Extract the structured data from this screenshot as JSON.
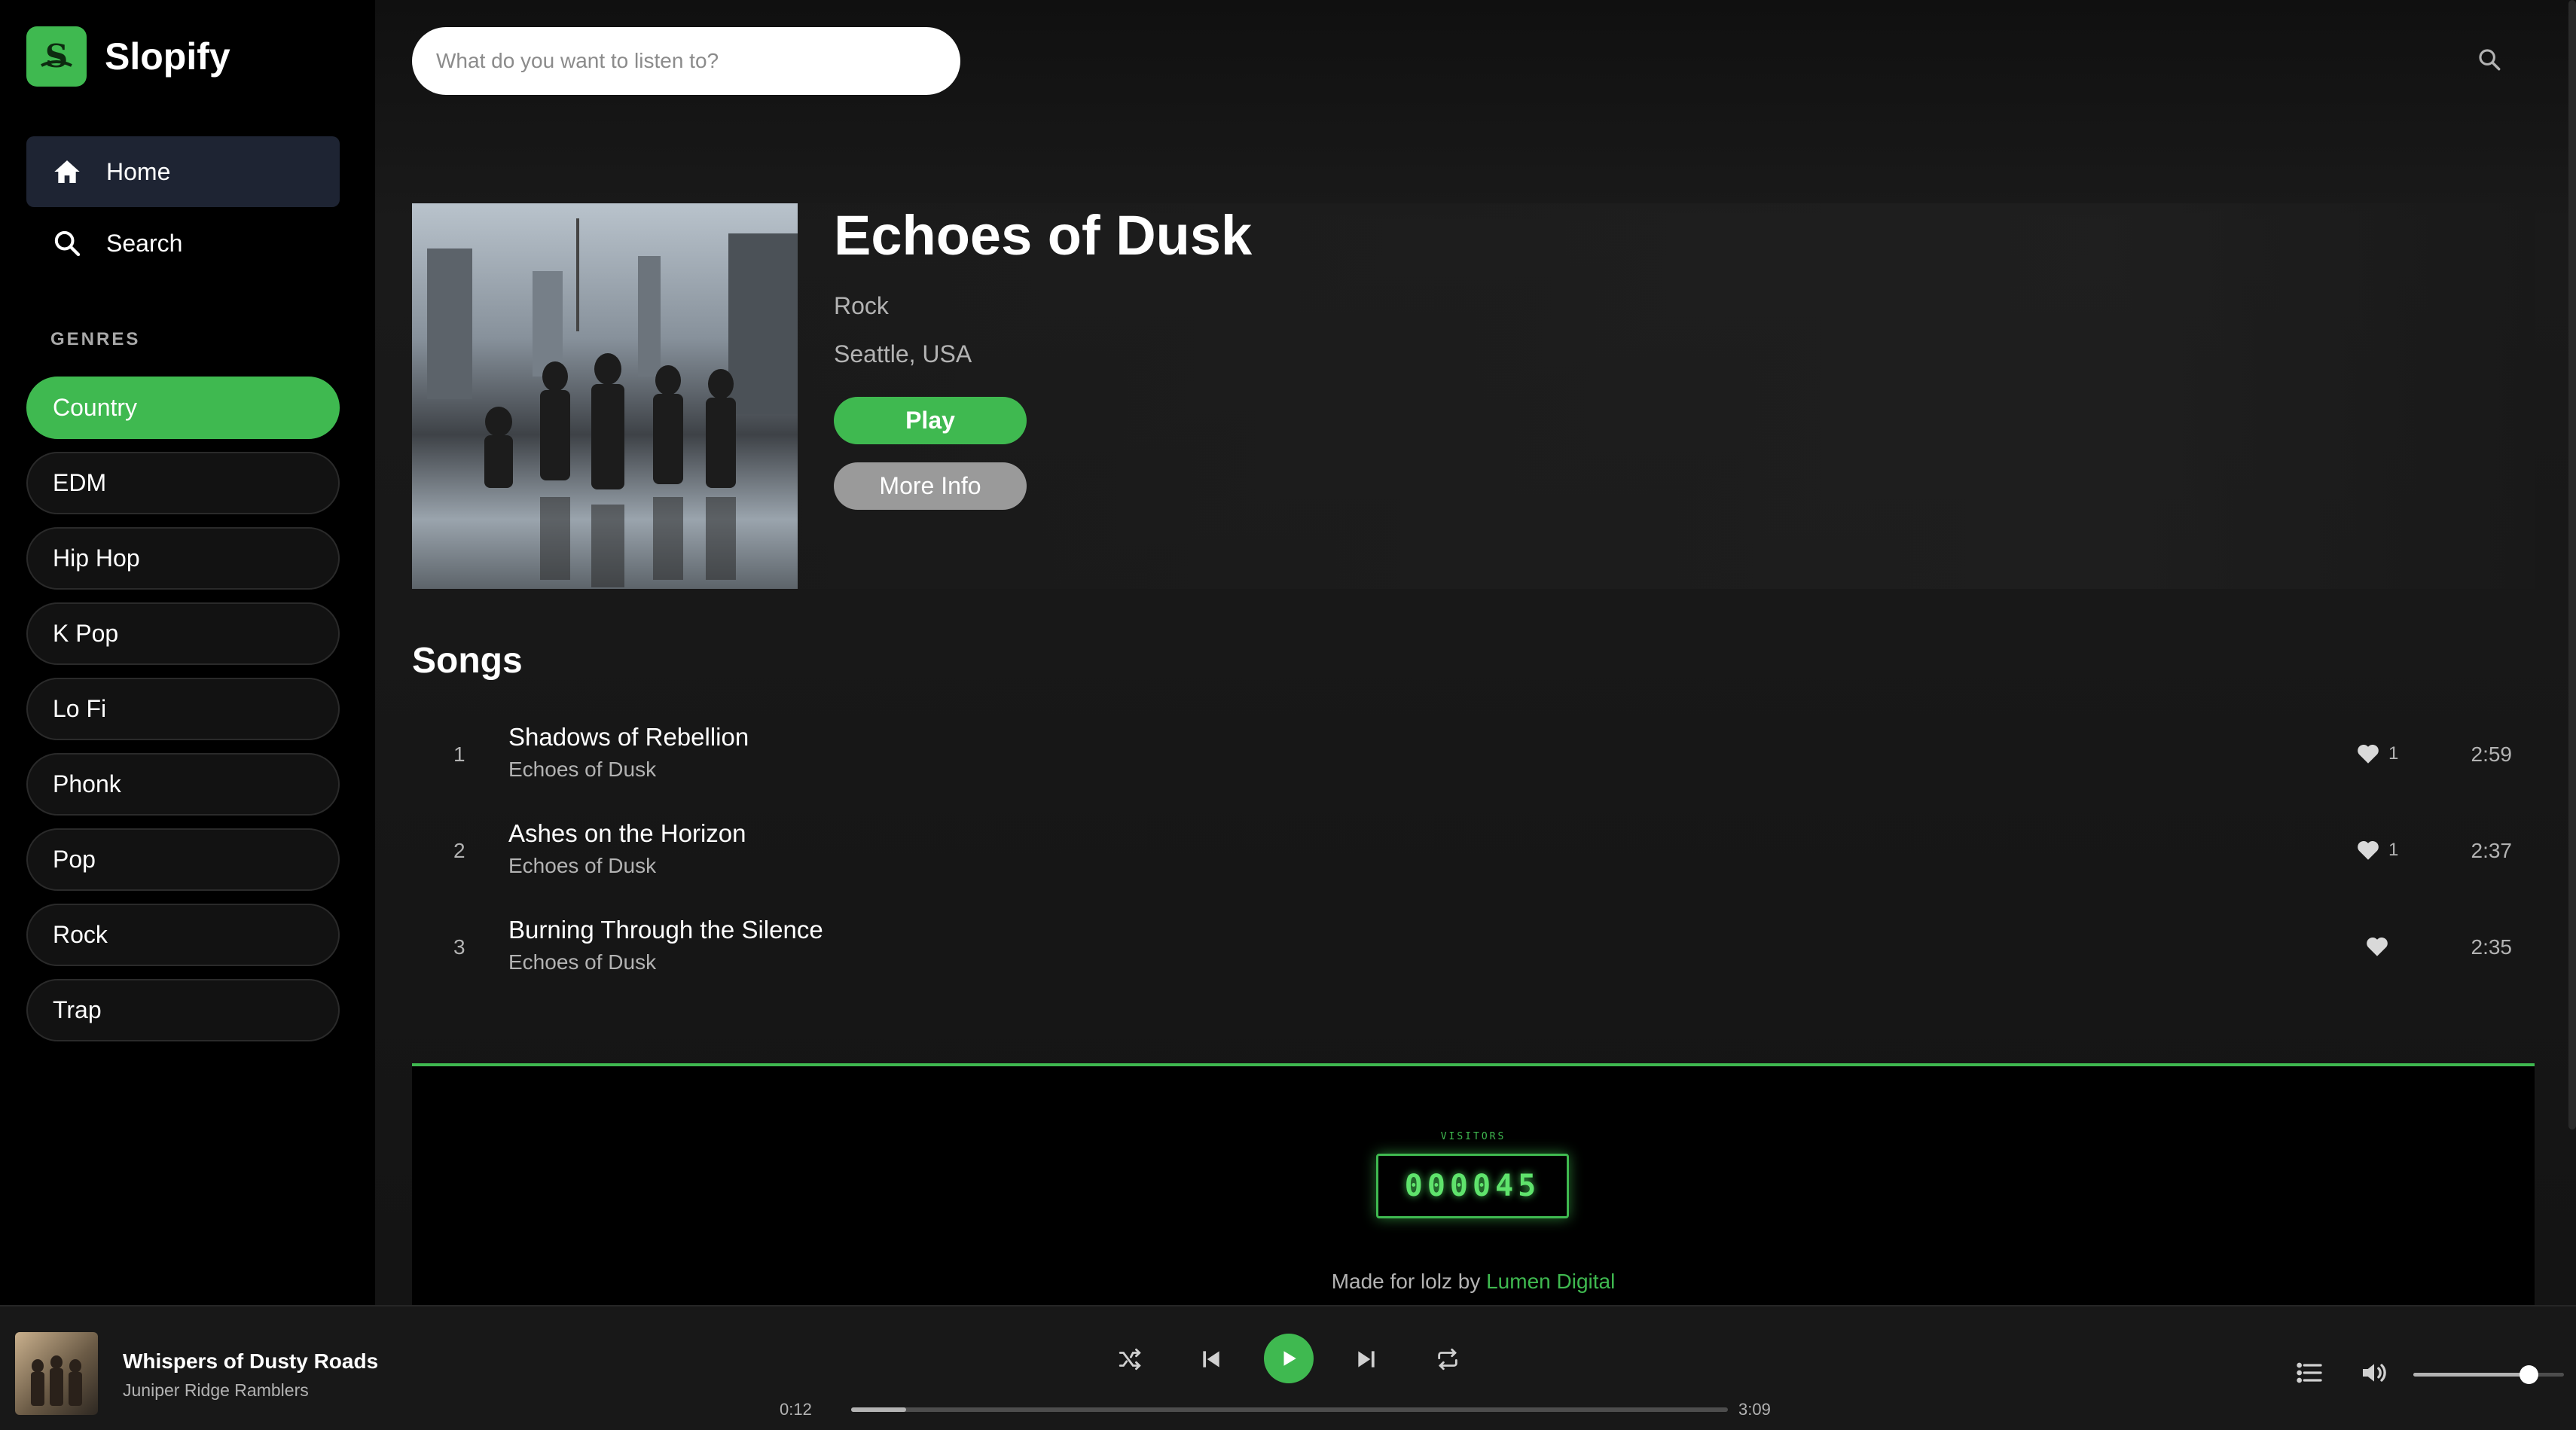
{
  "app": {
    "name": "Slopify",
    "accent": "#3fb950"
  },
  "sidebar": {
    "nav": [
      {
        "label": "Home",
        "icon": "home-icon",
        "active": true
      },
      {
        "label": "Search",
        "icon": "search-icon",
        "active": false
      }
    ],
    "genres_title": "GENRES",
    "genres": [
      {
        "label": "Country",
        "active": true
      },
      {
        "label": "EDM"
      },
      {
        "label": "Hip Hop"
      },
      {
        "label": "K Pop"
      },
      {
        "label": "Lo Fi"
      },
      {
        "label": "Phonk"
      },
      {
        "label": "Pop"
      },
      {
        "label": "Rock"
      },
      {
        "label": "Trap"
      }
    ]
  },
  "search": {
    "placeholder": "What do you want to listen to?"
  },
  "artist": {
    "name": "Echoes of Dusk",
    "genre": "Rock",
    "location": "Seattle, USA",
    "play_label": "Play",
    "more_info_label": "More Info"
  },
  "songs": {
    "title": "Songs",
    "items": [
      {
        "num": "1",
        "title": "Shadows of Rebellion",
        "artist": "Echoes of Dusk",
        "likes": "1",
        "duration": "2:59"
      },
      {
        "num": "2",
        "title": "Ashes on the Horizon",
        "artist": "Echoes of Dusk",
        "likes": "1",
        "duration": "2:37"
      },
      {
        "num": "3",
        "title": "Burning Through the Silence",
        "artist": "Echoes of Dusk",
        "likes": "",
        "duration": "2:35"
      }
    ]
  },
  "footer": {
    "visitors_label": "VISITORS",
    "visitor_count": "000045",
    "made_for_prefix": "Made for lolz by ",
    "credit": "Lumen Digital"
  },
  "player": {
    "track_title": "Whispers of Dusty Roads",
    "track_artist": "Juniper Ridge Ramblers",
    "elapsed": "0:12",
    "duration": "3:09",
    "progress_fraction": 0.063,
    "volume_fraction": 0.77
  }
}
